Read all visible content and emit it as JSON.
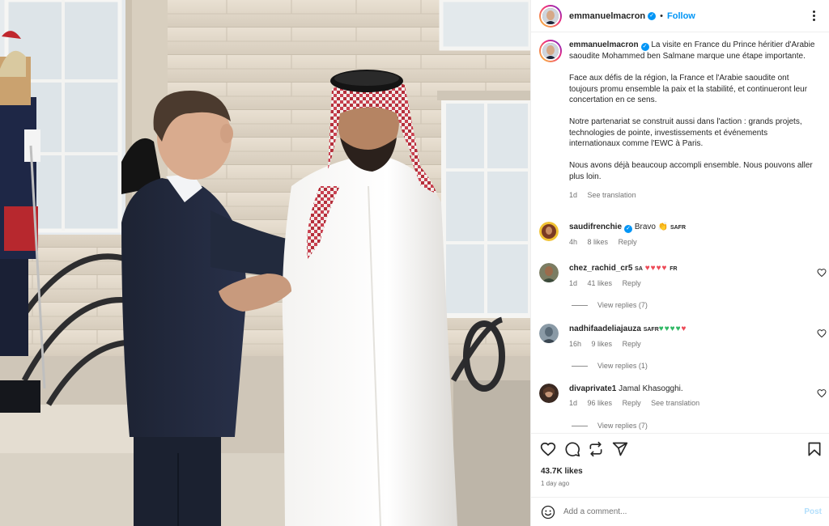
{
  "post": {
    "author": "emmanuelmacron",
    "follow_label": "Follow",
    "separator": "•",
    "caption_paragraphs": [
      "La visite en France du Prince héritier d'Arabie saoudite Mohammed ben Salmane marque une étape importante.",
      "Face aux défis de la région, la France et l'Arabie saoudite ont toujours promu ensemble la paix et la stabilité, et continueront leur concertation en ce sens.",
      "Notre partenariat se construit aussi dans l'action : grands projets, technologies de pointe, investissements et événements internationaux comme l'EWC à Paris.",
      "Nous avons déjà beaucoup accompli ensemble. Nous pouvons aller plus loin."
    ],
    "caption_time": "1d",
    "see_translation": "See translation",
    "likes": "43.7K likes",
    "posted_ago": "1 day ago"
  },
  "comments": [
    {
      "user": "saudifrenchie",
      "verified": true,
      "text": "Bravo",
      "emoji": "👏",
      "suffix": "SAFR",
      "time": "4h",
      "likes": "8 likes",
      "reply": "Reply"
    },
    {
      "user": "chez_rachid_cr5",
      "verified": false,
      "prefix": "SA",
      "text": "",
      "hearts": "♥♥♥♥",
      "suffix": "FR",
      "time": "1d",
      "likes": "41 likes",
      "reply": "Reply",
      "view_replies": "View replies (7)"
    },
    {
      "user": "nadhifaadeliajauza",
      "verified": false,
      "prefix": "SAFR",
      "text": "",
      "green_hearts": "♥♥♥♥",
      "hearts": "♥",
      "time": "16h",
      "likes": "9 likes",
      "reply": "Reply",
      "view_replies": "View replies (1)"
    },
    {
      "user": "divaprivate1",
      "verified": false,
      "text": "Jamal Khasogghi.",
      "time": "1d",
      "likes": "96 likes",
      "reply": "Reply",
      "see_translation": "See translation",
      "view_replies": "View replies (7)"
    }
  ],
  "composer": {
    "placeholder": "Add a comment...",
    "post_label": "Post"
  },
  "icons": {
    "more": "more-options-icon",
    "like": "heart-icon",
    "comment": "comment-icon",
    "share": "repost-icon",
    "send": "send-icon",
    "save": "bookmark-icon",
    "emoji": "emoji-icon",
    "verified": "verified-badge-icon"
  },
  "colors": {
    "accent": "#0095f6",
    "text": "#262626",
    "muted": "#737373",
    "like_red": "#ed4956",
    "post_disabled": "#b2dffc"
  }
}
